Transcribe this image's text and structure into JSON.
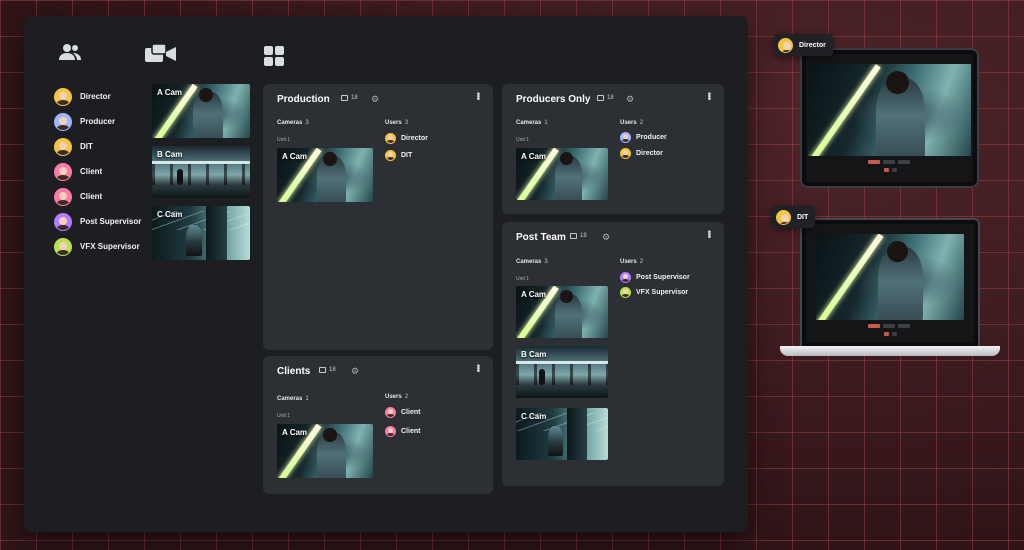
{
  "users": [
    {
      "name": "Director",
      "ring": "#f4c542"
    },
    {
      "name": "Producer",
      "ring": "#9fb7ff"
    },
    {
      "name": "DIT",
      "ring": "#f4c542"
    },
    {
      "name": "Client",
      "ring": "#ff7aa8"
    },
    {
      "name": "Client",
      "ring": "#ff7aa8"
    },
    {
      "name": "Post Supervisor",
      "ring": "#b47cff"
    },
    {
      "name": "VFX Supervisor",
      "ring": "#b9e34e"
    }
  ],
  "cameras": [
    {
      "label": "A Cam"
    },
    {
      "label": "B Cam"
    },
    {
      "label": "C Cam"
    }
  ],
  "toolbar": {
    "icons": [
      "users-icon",
      "cameras-icon",
      "grid-icon"
    ]
  },
  "groups": {
    "production": {
      "title": "Production",
      "count": "18",
      "cameras_label": "Cameras",
      "cameras_count": "3",
      "unit": "Unit 1",
      "users_label": "Users",
      "users_count": "3",
      "cam": "A Cam",
      "users": [
        "Director",
        "DIT"
      ]
    },
    "producers": {
      "title": "Producers Only",
      "count": "18",
      "cameras_label": "Cameras",
      "cameras_count": "1",
      "unit": "Unit 1",
      "users_label": "Users",
      "users_count": "2",
      "cam": "A Cam",
      "users": [
        "Producer",
        "Director"
      ]
    },
    "clients": {
      "title": "Clients",
      "count": "18",
      "cameras_label": "Cameras",
      "cameras_count": "1",
      "unit": "Unit 1",
      "users_label": "Users",
      "users_count": "2",
      "cam": "A Cam",
      "users": [
        "Client",
        "Client"
      ]
    },
    "post": {
      "title": "Post Team",
      "count": "18",
      "cameras_label": "Cameras",
      "cameras_count": "3",
      "unit": "Unit 1",
      "users_label": "Users",
      "users_count": "2",
      "cams": [
        "A Cam",
        "B Cam",
        "C Cam"
      ],
      "users": [
        "Post Supervisor",
        "VFX Supervisor"
      ]
    }
  },
  "devices": {
    "tablet_user": "Director",
    "laptop_user": "DIT"
  }
}
